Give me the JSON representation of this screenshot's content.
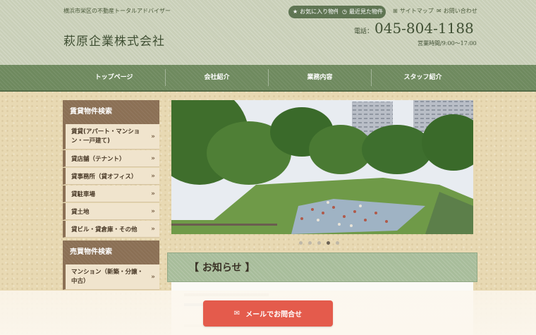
{
  "header": {
    "tagline": "横浜市栄区の不動産トータルアドバイザー",
    "company": "萩原企業株式会社",
    "favorites": "お気に入り物件",
    "recent": "最近見た物件",
    "sitemap": "サイトマップ",
    "contact": "お問い合わせ",
    "tel_label": "電話：",
    "tel": "045-804-1188",
    "hours": "営業時間/9:00～17:00"
  },
  "nav": {
    "items": [
      "トップページ",
      "会社紹介",
      "業務内容",
      "スタッフ紹介"
    ]
  },
  "sidebar": {
    "rent_title": "賃貸物件検索",
    "rent_items": [
      "賃貸(アパート・マンション・一戸建て)",
      "貸店舗（テナント）",
      "貸事務所（貸オフィス）",
      "貸駐車場",
      "貸土地",
      "貸ビル・貸倉庫・その他"
    ],
    "sale_title": "売買物件検索",
    "sale_items": [
      "マンション（新築・分譲・中古）"
    ]
  },
  "slider": {
    "dot_count": 5,
    "active_index": 3
  },
  "notice": {
    "title": "【 お知らせ 】"
  },
  "cta": {
    "mail_label": "メールでお問合せ"
  },
  "colors": {
    "header_bg": "#c9cfb8",
    "nav_bg": "#6f8a5f",
    "sidebar_head": "#8b7055",
    "cta": "#e45b4c"
  }
}
